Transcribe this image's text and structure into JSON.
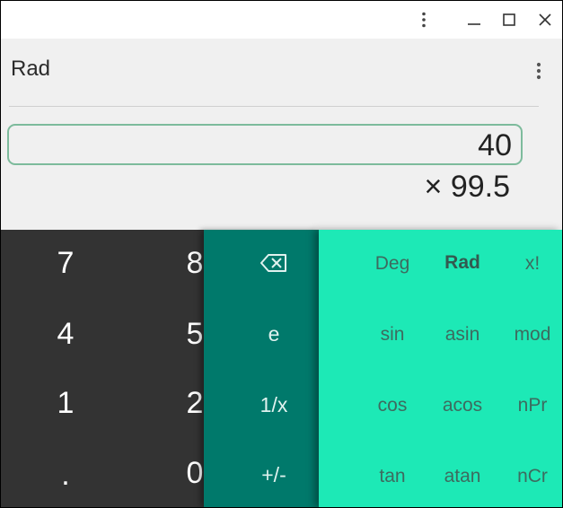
{
  "window": {
    "controls": [
      "more-vert-icon",
      "minimize-icon",
      "maximize-icon",
      "close-icon"
    ]
  },
  "display": {
    "mode": "Rad",
    "formula": "40",
    "result": "× 99.5"
  },
  "keypad": {
    "numbers": {
      "k7": "7",
      "k8": "8",
      "k4": "4",
      "k5": "5",
      "k1": "1",
      "k2": "2",
      "dot": ".",
      "k0": "0"
    },
    "operations": {
      "backspace": "⌫",
      "e": "e",
      "reciprocal": "1/x",
      "negate": "+/-"
    },
    "advanced": {
      "deg": "Deg",
      "rad": "Rad",
      "factorial": "x!",
      "sin": "sin",
      "asin": "asin",
      "mod": "mod",
      "cos": "cos",
      "acos": "acos",
      "npr": "nPr",
      "tan": "tan",
      "atan": "atan",
      "ncr": "nCr"
    }
  },
  "colors": {
    "numpad_bg": "#333333",
    "ops_bg": "#00796b",
    "advanced_bg": "#1de9b6",
    "display_bg": "#f0f0f0",
    "formula_border": "#7dbb9c"
  }
}
